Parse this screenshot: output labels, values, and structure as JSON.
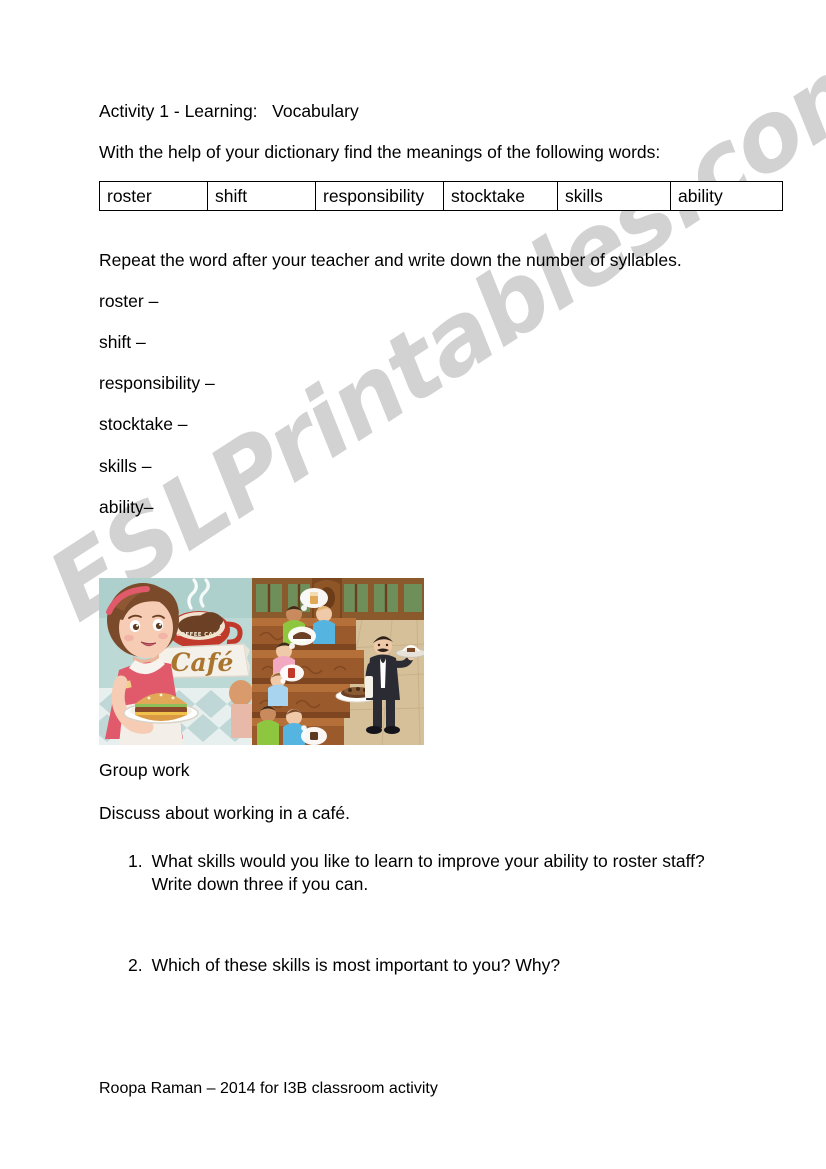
{
  "document": {
    "title": "Activity 1 - Learning:   Vocabulary",
    "intro": "With the help of your dictionary find the meanings of the following words:",
    "repeat_instruction": "Repeat the word after your teacher and write down the number of syllables.",
    "group_work_heading": "Group work",
    "discuss_line": "Discuss about working in a café.",
    "footer": "Roopa Raman – 2014 for I3B classroom activity"
  },
  "vocab_table": {
    "cells": [
      "roster",
      "shift",
      "responsibility",
      "stocktake",
      "skills",
      "ability"
    ]
  },
  "syllable_list": {
    "items": [
      "roster –",
      "shift –",
      "responsibility –",
      "stocktake –",
      "skills –",
      "ability–"
    ]
  },
  "questions": [
    {
      "number": "1.",
      "text": "What skills would you like to learn to improve your ability to roster staff? Write down three if you can."
    },
    {
      "number": "2.",
      "text": "Which of these skills is most important to you?  Why?"
    }
  ],
  "watermark": {
    "text": "ESLPrintables.com",
    "color": "#cfcfcf"
  },
  "figures": [
    {
      "name": "cafe-waitress-illustration",
      "caption_in_image": "Café",
      "sign_subtext": "COFFEE CAKE",
      "colors": {
        "wall": "#bdd9d6",
        "floor": "#dfe9e8",
        "dress": "#e05a6b",
        "hair": "#7a4a2b",
        "cup": "#c0392b",
        "bun": "#e0a857"
      }
    },
    {
      "name": "cafe-restaurant-game-illustration",
      "colors": {
        "wood": "#9b5a2b",
        "wood_dark": "#6f3d1c",
        "floor": "#d6c09a",
        "waiter_suit": "#2b2b33",
        "wall_window": "#6e8f5a"
      }
    }
  ]
}
